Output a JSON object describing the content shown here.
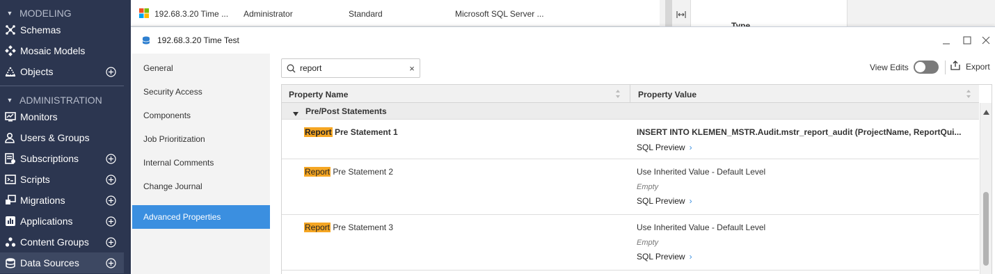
{
  "nav": {
    "modeling": {
      "label": "MODELING"
    },
    "administration": {
      "label": "ADMINISTRATION"
    },
    "items": [
      {
        "label": "Schemas",
        "icon": "schema-icon"
      },
      {
        "label": "Mosaic Models",
        "icon": "mosaic-icon"
      },
      {
        "label": "Objects",
        "icon": "objects-icon"
      },
      {
        "label": "Monitors",
        "icon": "monitor-icon"
      },
      {
        "label": "Users & Groups",
        "icon": "users-icon"
      },
      {
        "label": "Subscriptions",
        "icon": "subscriptions-icon"
      },
      {
        "label": "Scripts",
        "icon": "scripts-icon"
      },
      {
        "label": "Migrations",
        "icon": "migrations-icon"
      },
      {
        "label": "Applications",
        "icon": "applications-icon"
      },
      {
        "label": "Content Groups",
        "icon": "content-groups-icon"
      },
      {
        "label": "Data Sources",
        "icon": "database-icon"
      }
    ]
  },
  "background_row": {
    "name": "192.68.3.20 Time ...",
    "owner": "Administrator",
    "type": "Standard",
    "db": "Microsoft SQL Server ...",
    "right_header": "Type"
  },
  "dialog": {
    "title": "192.68.3.20 Time Test",
    "tabs": [
      "General",
      "Security Access",
      "Components",
      "Job Prioritization",
      "Internal Comments",
      "Change Journal",
      "Advanced Properties"
    ],
    "selected_tab": "Advanced Properties",
    "search": {
      "value": "report",
      "clear": "×"
    },
    "view_edits_label": "View Edits",
    "view_edits_on": false,
    "export_label": "Export",
    "grid": {
      "col_name": "Property Name",
      "col_value": "Property Value",
      "group": "Pre/Post Statements",
      "rows": [
        {
          "highlight": "Report",
          "rest": " Pre Statement 1",
          "value": "INSERT INTO KLEMEN_MSTR.Audit.mstr_report_audit (ProjectName, ReportQui...",
          "empty": "",
          "sql_preview": "SQL Preview"
        },
        {
          "highlight": "Report",
          "rest": " Pre Statement 2",
          "value": "Use Inherited Value - Default Level",
          "empty": "Empty",
          "sql_preview": "SQL Preview"
        },
        {
          "highlight": "Report",
          "rest": " Pre Statement 3",
          "value": "Use Inherited Value - Default Level",
          "empty": "Empty",
          "sql_preview": "SQL Preview"
        }
      ]
    }
  },
  "colors": {
    "nav_bg": "#2c3650",
    "accent": "#3b8fe0",
    "highlight": "#f5a623"
  }
}
